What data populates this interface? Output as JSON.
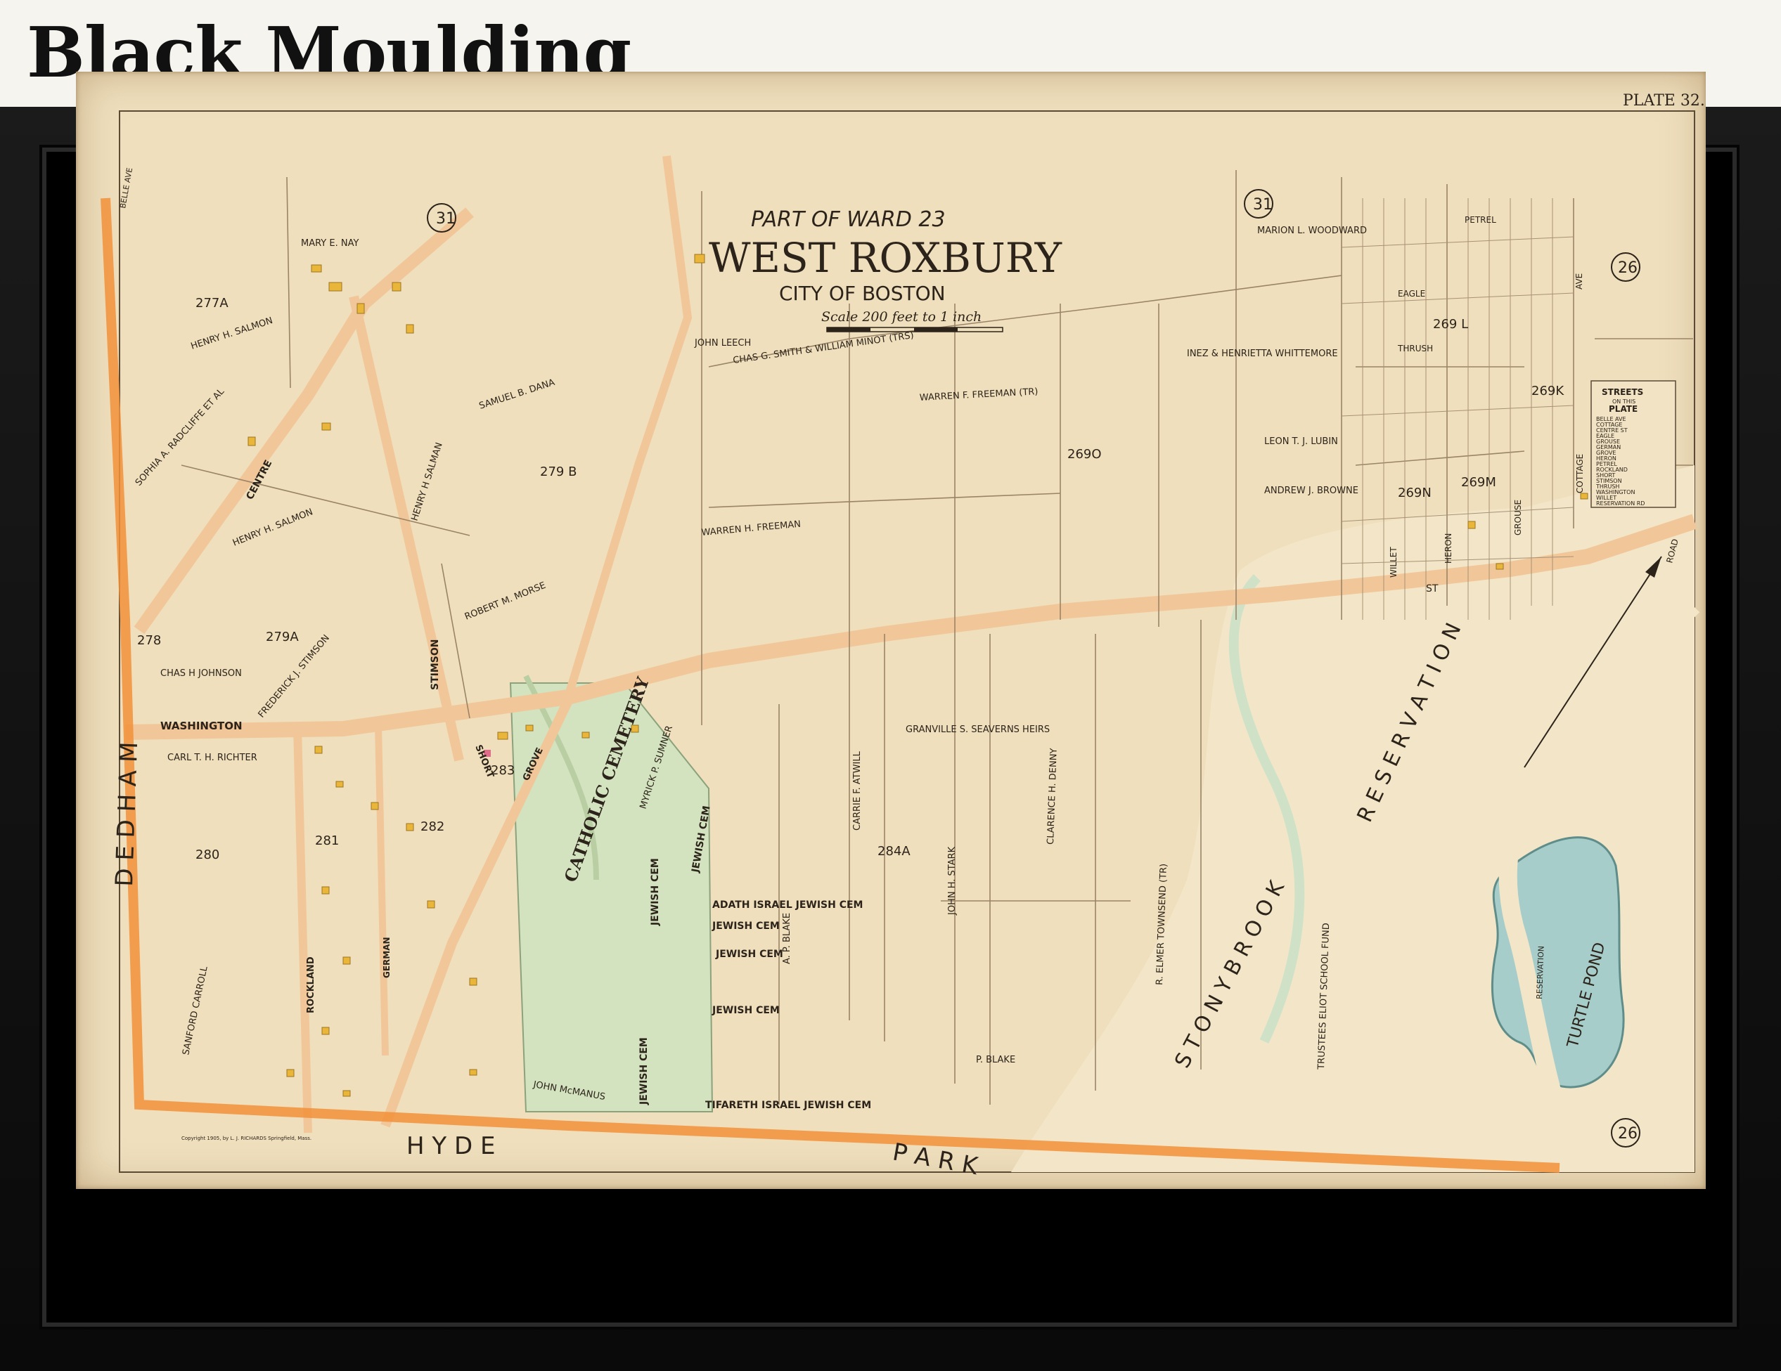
{
  "header": {
    "title": "Black Moulding"
  },
  "map": {
    "plate_label": "PLATE 32.",
    "subtitle": "PART OF WARD 23",
    "title": "WEST ROXBURY",
    "city": "CITY OF BOSTON",
    "scale_text": "Scale 200 feet to 1 inch",
    "copyright": "Copyright 1905, by L. J. RICHARDS Springfield, Mass.",
    "plate_refs": {
      "top_left": "31",
      "top_mid": "31",
      "top_right": "26",
      "bottom_right": "26"
    },
    "legend": {
      "title": "STREETS",
      "subtitle": "ON THIS",
      "plate": "PLATE",
      "items": [
        "BELLE AVE",
        "COTTAGE",
        "CENTRE ST",
        "EAGLE",
        "GROUSE",
        "GERMAN",
        "GROVE",
        "HERON",
        "PETREL",
        "ROCKLAND",
        "SHORT",
        "STIMSON",
        "THRUSH",
        "WASHINGTON",
        "WILLET",
        "RESERVATION RD"
      ]
    },
    "streets": {
      "washington": "WASHINGTON",
      "st": "ST",
      "centre": "CENTRE",
      "stimson": "STIMSON",
      "rockland": "ROCKLAND",
      "german": "GERMAN",
      "grove": "GROVE",
      "short": "SHORT",
      "dedham": "D E D H A M",
      "hyde": "H Y D E",
      "park": "P A R K",
      "stony_brook": "S T O N Y   B R O O K",
      "reservation": "R E S E R V A T I O N",
      "petrel": "PETREL",
      "eagle": "EAGLE",
      "thrush": "THRUSH",
      "willet": "WILLET",
      "heron": "HERON",
      "grouse": "GROUSE",
      "cottage": "COTTAGE",
      "ave": "AVE",
      "road": "ROAD",
      "reservation_rd": "RESERVATION",
      "belle_ave": "BELLE AVE"
    },
    "parcels": {
      "p277a": "277A",
      "p279b": "279 B",
      "p279a": "279A",
      "p278": "278",
      "p280": "280",
      "p281": "281",
      "p282": "282",
      "p283": "283",
      "p284a": "284A",
      "p269o": "269O",
      "p269l": "269 L",
      "p269k": "269K",
      "p269m": "269M",
      "p269n": "269N"
    },
    "owners": {
      "mary_nay": "MARY E. NAY",
      "salmon1": "HENRY H. SALMON",
      "salmon2": "HENRY H. SALMON",
      "salmon3": "HENRY H SALMAN",
      "dana": "SAMUEL B. DANA",
      "morse": "ROBERT M. MORSE",
      "stimson": "FREDERICK J. STIMSON",
      "johnson": "CHAS H JOHNSON",
      "richter": "CARL T. H. RICHTER",
      "carroll": "SANFORD CARROLL",
      "mcmanus": "JOHN McMANUS",
      "sumner": "MYRICK P. SUMNER",
      "blake1": "P. BLAKE",
      "blake2": "A. P. BLAKE",
      "atwill": "CARRIE F. ATWILL",
      "stark": "JOHN H. STARK",
      "denny": "CLARENCE H. DENNY",
      "townsend": "R. ELMER TOWNSEND (TR)",
      "freeman1": "WARREN F. FREEMAN (TR)",
      "freeman2": "WARREN H. FREEMAN",
      "whittemore": "INEZ & HENRIETTA WHITTEMORE",
      "browne": "ANDREW J. BROWNE",
      "lubin": "LEON T. J. LUBIN",
      "woodward": "MARION L. WOODWARD",
      "seaverns": "GRANVILLE S. SEAVERNS HEIRS",
      "smith_minot": "CHAS G. SMITH & WILLIAM MINOT (TRS)",
      "leech": "JOHN LEECH",
      "sradcliffe": "SOPHIA A. RADCLIFFE ET AL",
      "eliot": "TRUSTEES ELIOT SCHOOL FUND"
    },
    "cemeteries": {
      "catholic": "CATHOLIC CEMETERY",
      "jewish1": "JEWISH CEM",
      "jewish2": "JEWISH CEM",
      "jewish3": "JEWISH CEM",
      "adath": "ADATH ISRAEL JEWISH CEM",
      "jewish4": "JEWISH CEM",
      "tifareth": "TIFARETH ISRAEL JEWISH CEM",
      "jewish5": "JEWISH CEM",
      "jewish6": "JEWISH CEM"
    },
    "pond": "TURTLE POND",
    "colors": {
      "paper": "#efdfbd",
      "road": "#f1c79a",
      "boundary": "#f2913a",
      "cemetery": "#d3e2bf",
      "water": "#a6cdca",
      "building": "#e9b63a"
    }
  }
}
